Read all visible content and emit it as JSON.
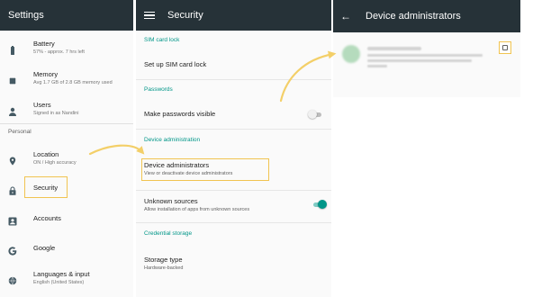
{
  "settings": {
    "title": "Settings",
    "items": [
      {
        "label": "Battery",
        "sub": "57% - approx. 7 hrs left",
        "icon": "battery-icon"
      },
      {
        "label": "Memory",
        "sub": "Avg 1.7 GB of 2.8 GB memory used",
        "icon": "memory-icon"
      },
      {
        "label": "Users",
        "sub": "Signed in as Nandini",
        "icon": "person-icon"
      }
    ],
    "section_personal": "Personal",
    "personal_items": [
      {
        "label": "Location",
        "sub": "ON / High accuracy",
        "icon": "location-pin-icon"
      },
      {
        "label": "Security",
        "sub": "",
        "icon": "lock-icon"
      },
      {
        "label": "Accounts",
        "sub": "",
        "icon": "account-icon"
      },
      {
        "label": "Google",
        "sub": "",
        "icon": "google-icon"
      },
      {
        "label": "Languages & input",
        "sub": "English (United States)",
        "icon": "globe-icon"
      }
    ]
  },
  "security": {
    "title": "Security",
    "cat_sim": "SIM card lock",
    "sim_item": "Set up SIM card lock",
    "cat_passwords": "Passwords",
    "passwords_item": "Make passwords visible",
    "cat_device_admin": "Device administration",
    "device_admins_label": "Device administrators",
    "device_admins_sub": "View or deactivate device administrators",
    "unknown_sources_label": "Unknown sources",
    "unknown_sources_sub": "Allow installation of apps from unknown sources",
    "cat_credential": "Credential storage",
    "storage_type_label": "Storage type",
    "storage_type_sub": "Hardware-backed",
    "toggles": {
      "passwords_visible": false,
      "unknown_sources": true
    }
  },
  "device_admins": {
    "title": "Device administrators",
    "checked": false
  },
  "colors": {
    "appbar": "#263238",
    "accent": "#009688",
    "highlight": "#f1c451",
    "arrow": "#f3cf68"
  }
}
